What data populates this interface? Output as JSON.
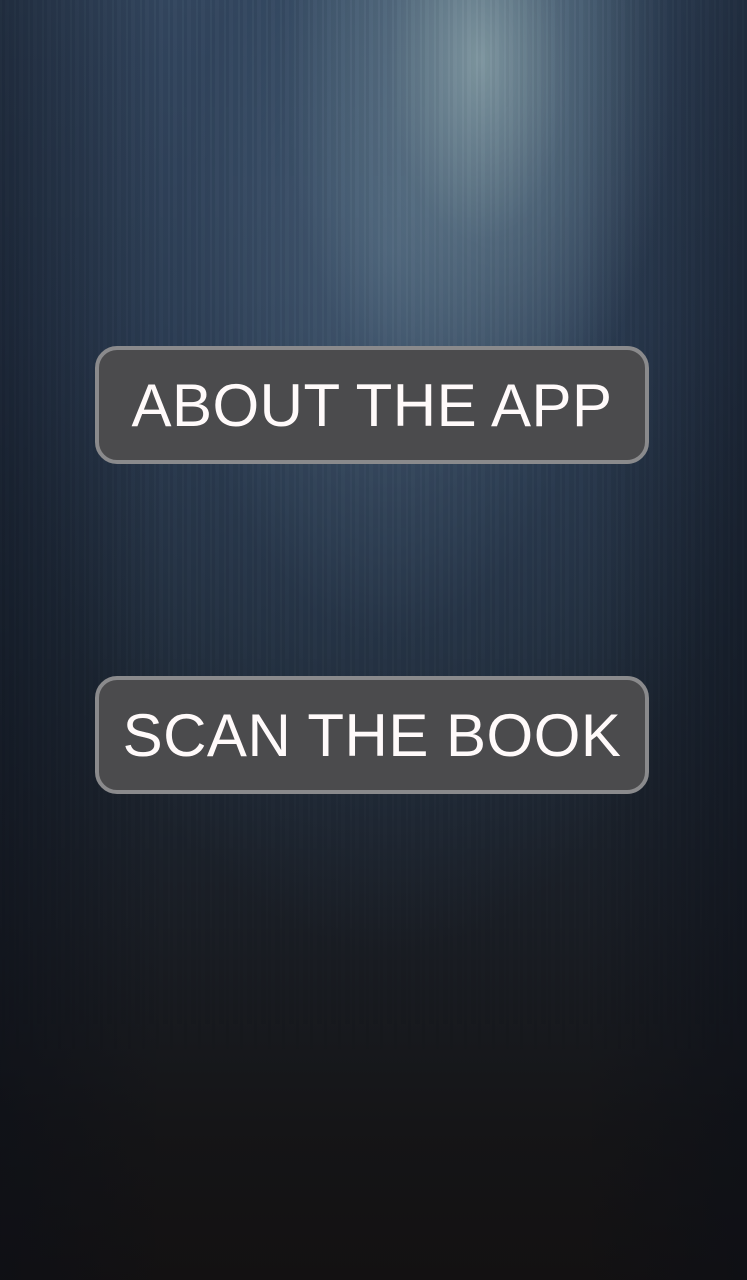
{
  "menu": {
    "about_label": "ABOUT THE APP",
    "scan_label": "SCAN THE BOOK"
  },
  "colors": {
    "button_background": "#4b4b4d",
    "button_border": "#8a8a8c",
    "button_text": "#fffafa"
  }
}
